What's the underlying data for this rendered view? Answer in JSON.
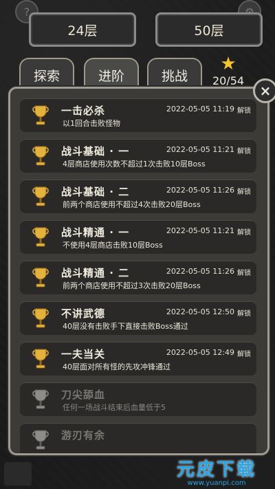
{
  "floors": {
    "current": "24层",
    "max": "50层"
  },
  "tabs": [
    {
      "label": "探索",
      "active": false
    },
    {
      "label": "进阶",
      "active": true
    },
    {
      "label": "挑战",
      "active": false
    }
  ],
  "stars": {
    "icon": "star-icon",
    "count": "20/54"
  },
  "close_icon": "×",
  "achievements": [
    {
      "title": "一击必杀",
      "desc": "以1回合击败怪物",
      "time": "2022-05-05 11:19",
      "status": "解锁",
      "locked": false
    },
    {
      "title": "战斗基础 · 一",
      "desc": "4层商店使用次数不超过1次击败10层Boss",
      "time": "2022-05-05 11:21",
      "status": "解锁",
      "locked": false
    },
    {
      "title": "战斗基础 · 二",
      "desc": "前两个商店使用不超过4次击败20层Boss",
      "time": "2022-05-05 11:26",
      "status": "解锁",
      "locked": false
    },
    {
      "title": "战斗精通 · 一",
      "desc": "不使用4层商店击败10层Boss",
      "time": "2022-05-05 11:21",
      "status": "解锁",
      "locked": false
    },
    {
      "title": "战斗精通 · 二",
      "desc": "前两个商店使用不超过3次击败20层Boss",
      "time": "2022-05-05 11:26",
      "status": "解锁",
      "locked": false
    },
    {
      "title": "不讲武德",
      "desc": "40层没有击败手下直接击败Boss通过",
      "time": "2022-05-05 12:50",
      "status": "解锁",
      "locked": false
    },
    {
      "title": "一夫当关",
      "desc": "40层面对所有怪的先攻冲锋通过",
      "time": "2022-05-05 12:49",
      "status": "解锁",
      "locked": false
    },
    {
      "title": "刀尖舔血",
      "desc": "任何一场战斗结束后血量低于5",
      "time": "",
      "status": "",
      "locked": true
    },
    {
      "title": "游刃有余",
      "desc": "",
      "time": "",
      "status": "",
      "locked": true
    }
  ],
  "watermark": {
    "main": "元皮下载",
    "sub": "www.yuanpi.com"
  },
  "colors": {
    "gold": "#f3c332",
    "locked_gray": "#7b7873",
    "watermark_blue": "#2aa6e6"
  }
}
